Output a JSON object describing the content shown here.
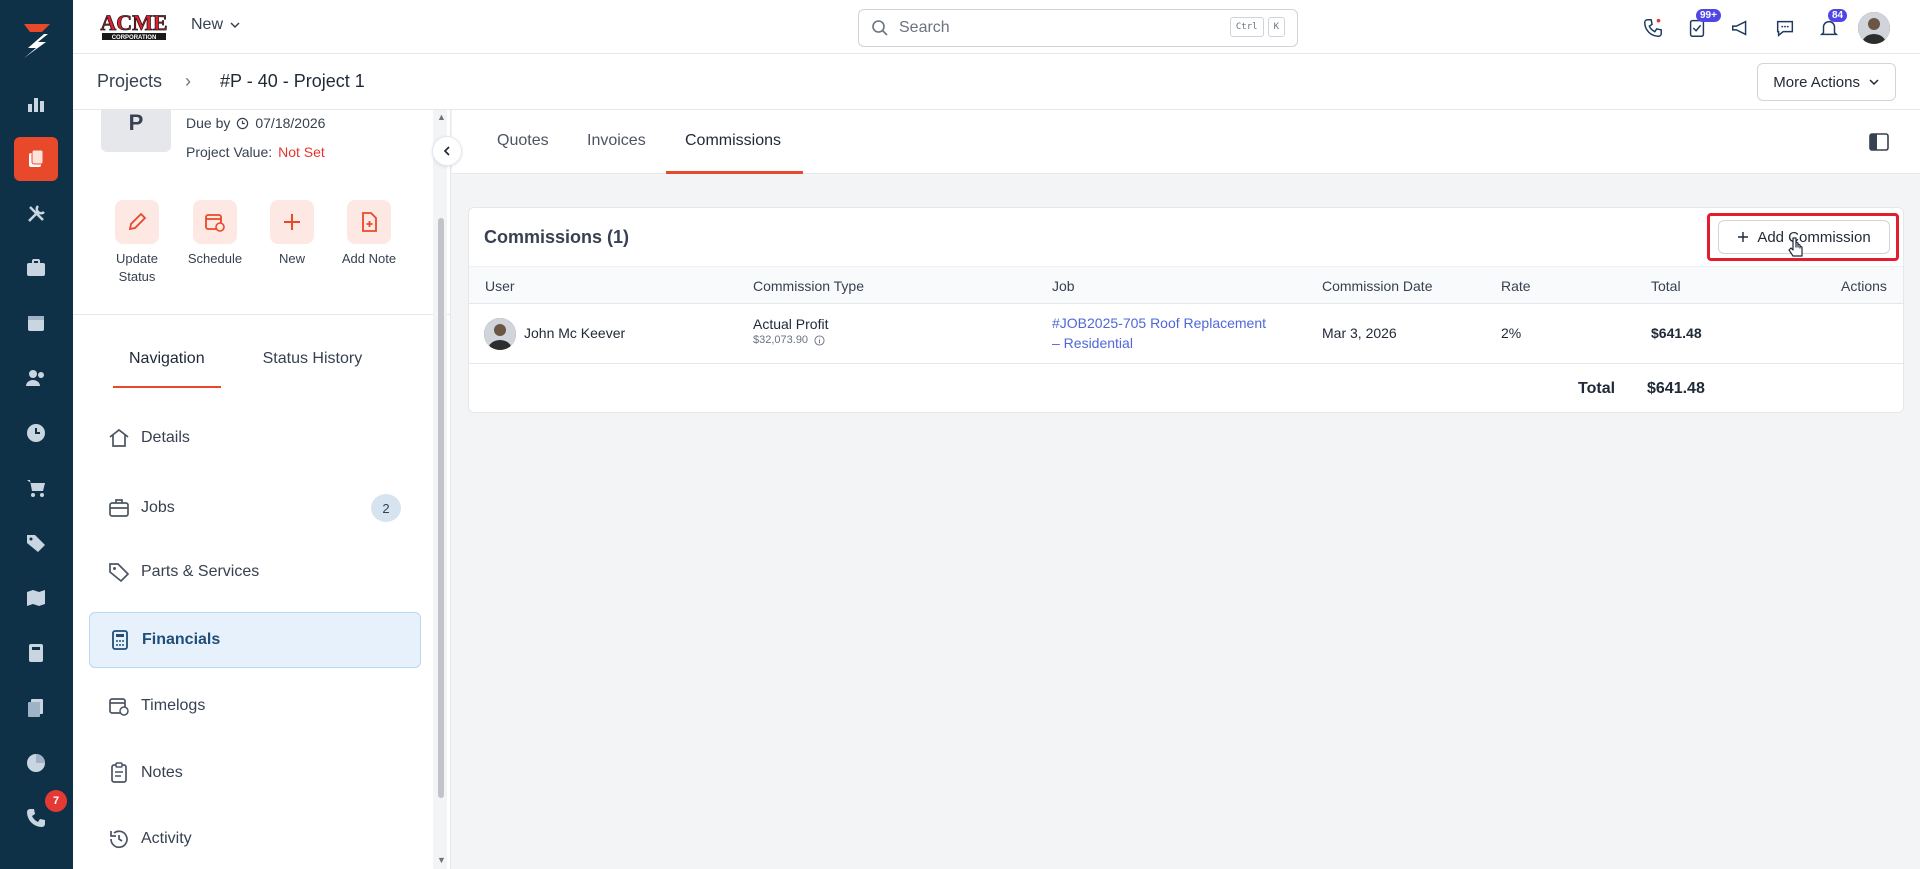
{
  "brand": {
    "name": "ACME",
    "tagline": "CORPORATION"
  },
  "topbar": {
    "new_label": "New",
    "search_placeholder": "Search",
    "kbd1": "Ctrl",
    "kbd2": "K",
    "tasks_badge": "99+",
    "notif_badge": "84"
  },
  "rail": {
    "phone_badge": "7"
  },
  "breadcrumb": {
    "root": "Projects",
    "sep": "›",
    "current": "#P - 40 - Project 1"
  },
  "more_actions": "More Actions",
  "project": {
    "avatar_letter": "P",
    "due_label": "Due by",
    "due_date": "07/18/2026",
    "value_label": "Project Value:",
    "value": "Not Set"
  },
  "actions": [
    {
      "label": "Update Status"
    },
    {
      "label": "Schedule"
    },
    {
      "label": "New"
    },
    {
      "label": "Add Note"
    }
  ],
  "panel_tabs": {
    "navigation": "Navigation",
    "history": "Status History"
  },
  "nav": {
    "details": "Details",
    "jobs": "Jobs",
    "jobs_count": "2",
    "parts": "Parts & Services",
    "financials": "Financials",
    "timelogs": "Timelogs",
    "notes": "Notes",
    "activity": "Activity"
  },
  "main_tabs": {
    "quotes": "Quotes",
    "invoices": "Invoices",
    "commissions": "Commissions"
  },
  "commissions": {
    "title": "Commissions (1)",
    "add_label": "Add Commission",
    "columns": {
      "user": "User",
      "type": "Commission Type",
      "job": "Job",
      "date": "Commission Date",
      "rate": "Rate",
      "total": "Total",
      "actions": "Actions"
    },
    "rows": [
      {
        "user": "John Mc Keever",
        "type": "Actual Profit",
        "type_sub": "$32,073.90",
        "job_line1": "#JOB2025-705 Roof Replacement",
        "job_line2": "– Residential",
        "date": "Mar 3, 2026",
        "rate": "2%",
        "total": "$641.48"
      }
    ],
    "footer_label": "Total",
    "footer_value": "$641.48"
  },
  "colors": {
    "accent": "#e8492a",
    "rail": "#0f3148",
    "link": "#4f67d9",
    "highlight": "#e11d2e"
  }
}
